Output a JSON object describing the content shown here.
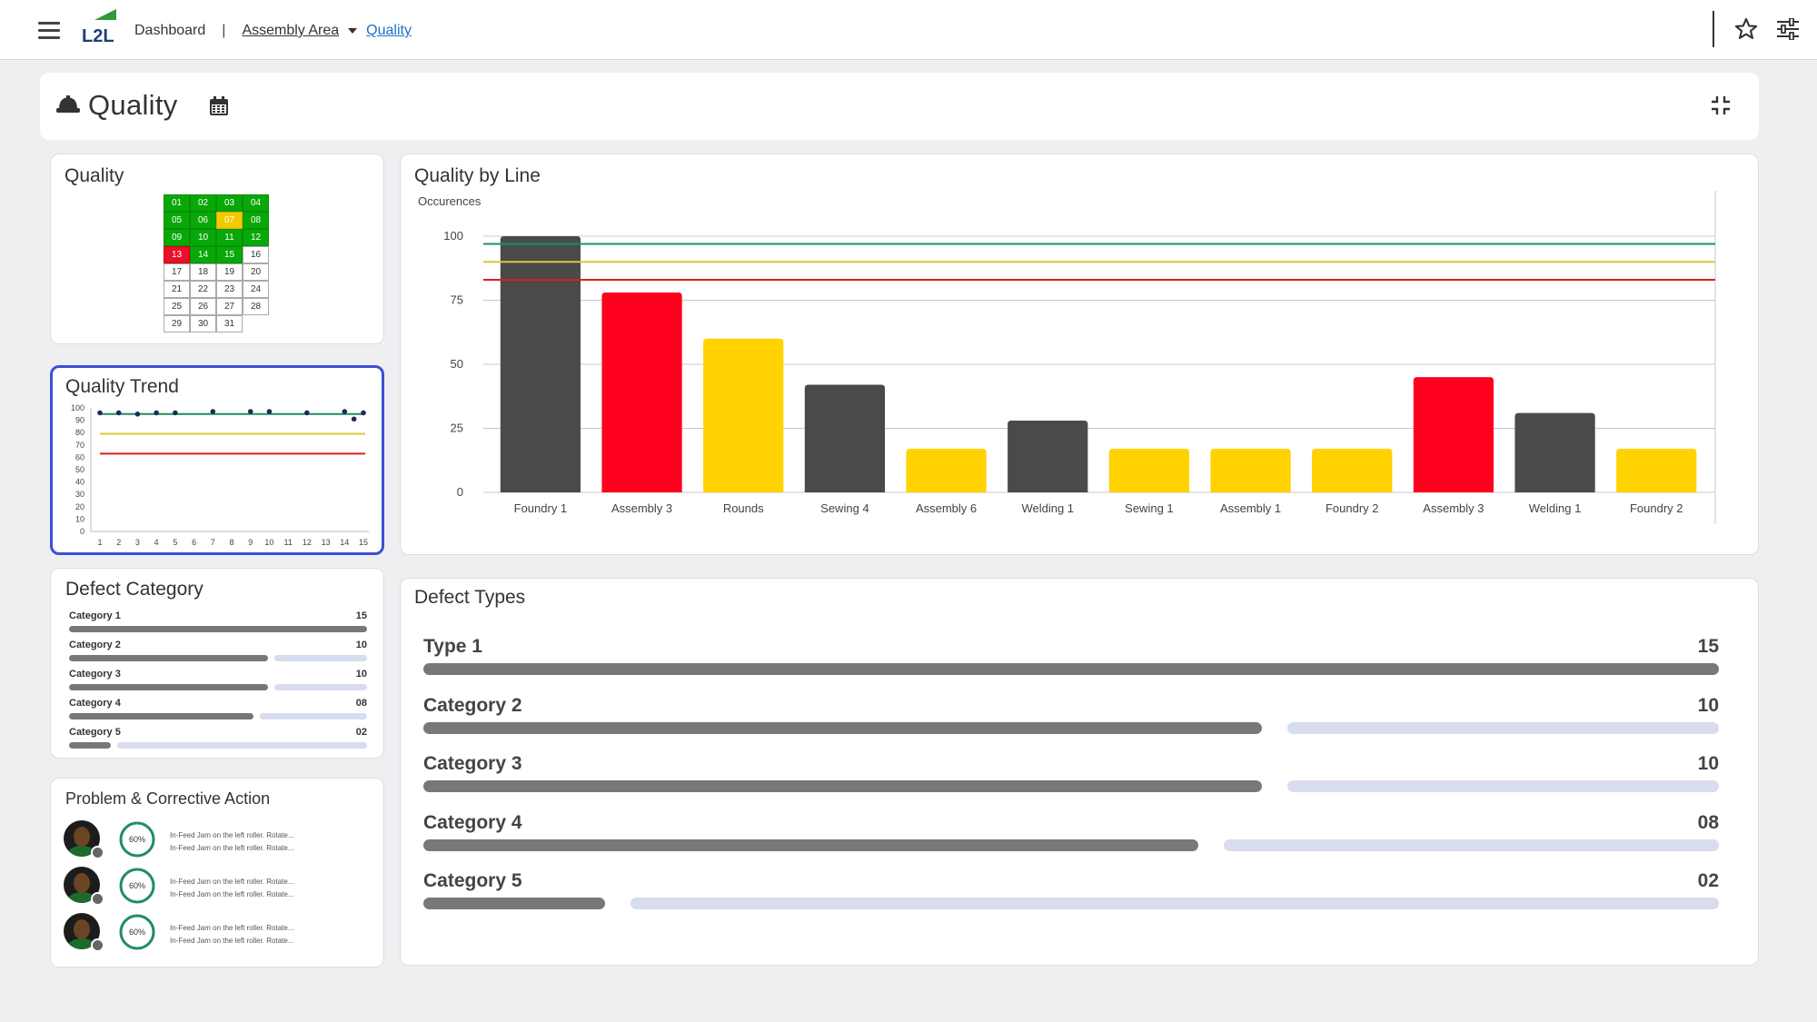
{
  "topbar": {
    "logo_text": "L2L",
    "breadcrumb_dashboard": "Dashboard",
    "breadcrumb_separator": "|",
    "breadcrumb_area": "Assembly Area",
    "breadcrumb_current": "Quality"
  },
  "header": {
    "title": "Quality"
  },
  "quality_card": {
    "title": "Quality",
    "days": [
      {
        "d": "01",
        "s": "green"
      },
      {
        "d": "02",
        "s": "green"
      },
      {
        "d": "03",
        "s": "green"
      },
      {
        "d": "04",
        "s": "green"
      },
      {
        "d": "05",
        "s": "green"
      },
      {
        "d": "06",
        "s": "green"
      },
      {
        "d": "07",
        "s": "yellow"
      },
      {
        "d": "08",
        "s": "green"
      },
      {
        "d": "09",
        "s": "green"
      },
      {
        "d": "10",
        "s": "green"
      },
      {
        "d": "11",
        "s": "green"
      },
      {
        "d": "12",
        "s": "green"
      },
      {
        "d": "13",
        "s": "red"
      },
      {
        "d": "14",
        "s": "green"
      },
      {
        "d": "15",
        "s": "green"
      },
      {
        "d": "16",
        "s": "none"
      },
      {
        "d": "17",
        "s": "none"
      },
      {
        "d": "18",
        "s": "none"
      },
      {
        "d": "19",
        "s": "none"
      },
      {
        "d": "20",
        "s": "none"
      },
      {
        "d": "21",
        "s": "none"
      },
      {
        "d": "22",
        "s": "none"
      },
      {
        "d": "23",
        "s": "none"
      },
      {
        "d": "24",
        "s": "none"
      },
      {
        "d": "25",
        "s": "none"
      },
      {
        "d": "26",
        "s": "none"
      },
      {
        "d": "27",
        "s": "none"
      },
      {
        "d": "28",
        "s": "none"
      },
      {
        "d": "29",
        "s": "none"
      },
      {
        "d": "30",
        "s": "none"
      },
      {
        "d": "31",
        "s": "none"
      }
    ],
    "status_colors": {
      "green": "#08a808",
      "yellow": "#f5c800",
      "red": "#e8102a"
    }
  },
  "trend_card": {
    "title": "Quality Trend"
  },
  "defect_category_card": {
    "title": "Defect Category",
    "rows": [
      {
        "label": "Category 1",
        "value": "15",
        "fraction": 1.0
      },
      {
        "label": "Category 2",
        "value": "10",
        "fraction": 0.667
      },
      {
        "label": "Category 3",
        "value": "10",
        "fraction": 0.667
      },
      {
        "label": "Category 4",
        "value": "08",
        "fraction": 0.62
      },
      {
        "label": "Category 5",
        "value": "02",
        "fraction": 0.14
      }
    ]
  },
  "pca_card": {
    "title": "Problem & Corrective Action",
    "items": [
      {
        "percent": "60%",
        "percent_value": 60,
        "line1": "In-Feed Jam on the left roller. Rotate...",
        "line2": "In-Feed Jam on the left roller. Rotate..."
      },
      {
        "percent": "60%",
        "percent_value": 60,
        "line1": "In-Feed Jam on the left roller. Rotate...",
        "line2": "In-Feed Jam on the left roller. Rotate..."
      },
      {
        "percent": "60%",
        "percent_value": 60,
        "line1": "In-Feed Jam on the left roller. Rotate...",
        "line2": "In-Feed Jam on the left roller. Rotate..."
      }
    ]
  },
  "qbl_card": {
    "title": "Quality by Line"
  },
  "defect_types_card": {
    "title": "Defect Types",
    "rows": [
      {
        "label": "Type 1",
        "value": "15",
        "fraction": 1.0
      },
      {
        "label": "Category 2",
        "value": "10",
        "fraction": 0.647
      },
      {
        "label": "Category 3",
        "value": "10",
        "fraction": 0.647
      },
      {
        "label": "Category 4",
        "value": "08",
        "fraction": 0.598
      },
      {
        "label": "Category 5",
        "value": "02",
        "fraction": 0.14
      }
    ]
  },
  "colors": {
    "bar_gray": "#4a4a4a",
    "bar_red": "#ff001f",
    "bar_yellow": "#ffd200",
    "target_green": "#1f8f5f",
    "target_yellow": "#d8c83a",
    "target_red": "#d62020",
    "progress_gray": "#787878",
    "progress_track": "#d8dcef",
    "accent_blue": "#1a73c8",
    "selected_border": "#3c4fd6"
  },
  "chart_data": [
    {
      "type": "bar",
      "title": "Quality by Line",
      "ylabel": "Occurences",
      "ylim": [
        0,
        100
      ],
      "yticks": [
        0,
        25,
        50,
        75,
        100
      ],
      "categories": [
        "Foundry 1",
        "Assembly 3",
        "Rounds",
        "Sewing 4",
        "Assembly 6",
        "Welding 1",
        "Sewing 1",
        "Assembly 1",
        "Foundry 2",
        "Assembly 3",
        "Welding 1",
        "Foundry 2"
      ],
      "values": [
        100,
        78,
        60,
        42,
        17,
        28,
        17,
        17,
        17,
        45,
        31,
        17
      ],
      "bar_colors": [
        "gray",
        "red",
        "yellow",
        "gray",
        "yellow",
        "gray",
        "yellow",
        "yellow",
        "yellow",
        "red",
        "gray",
        "yellow"
      ],
      "reference_lines": [
        {
          "value": 97,
          "color": "green"
        },
        {
          "value": 90,
          "color": "yellow"
        },
        {
          "value": 83,
          "color": "red"
        }
      ],
      "grid": true
    },
    {
      "type": "scatter",
      "title": "Quality Trend",
      "ylim": [
        0,
        100
      ],
      "yticks": [
        0,
        10,
        20,
        30,
        40,
        50,
        60,
        70,
        80,
        90,
        100
      ],
      "xticks": [
        1,
        2,
        3,
        4,
        5,
        6,
        7,
        8,
        9,
        10,
        11,
        12,
        13,
        14,
        15
      ],
      "points": [
        {
          "x": 1,
          "y": 96
        },
        {
          "x": 2,
          "y": 96
        },
        {
          "x": 3,
          "y": 95
        },
        {
          "x": 4,
          "y": 96
        },
        {
          "x": 5,
          "y": 96
        },
        {
          "x": 7,
          "y": 97
        },
        {
          "x": 9,
          "y": 97
        },
        {
          "x": 10,
          "y": 97
        },
        {
          "x": 12,
          "y": 96
        },
        {
          "x": 14,
          "y": 97
        },
        {
          "x": 14.5,
          "y": 91
        },
        {
          "x": 15,
          "y": 96
        }
      ],
      "reference_lines": [
        {
          "value": 95,
          "color": "green"
        },
        {
          "value": 79,
          "color": "yellow"
        },
        {
          "value": 63,
          "color": "red"
        }
      ]
    }
  ]
}
